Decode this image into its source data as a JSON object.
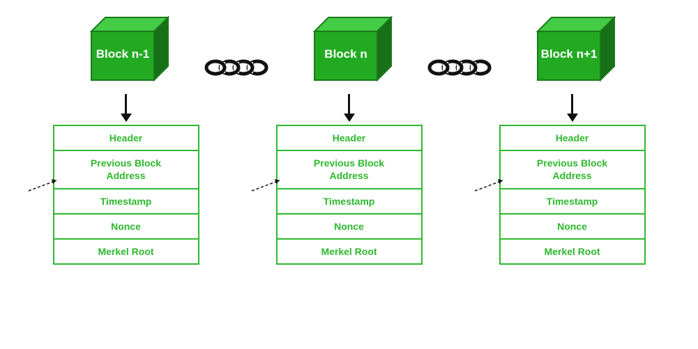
{
  "blocks": [
    {
      "id": "block-n-minus-1",
      "label": "Block n-1",
      "fields": [
        "Header",
        "Previous Block Address",
        "Timestamp",
        "Nonce",
        "Merkel Root"
      ]
    },
    {
      "id": "block-n",
      "label": "Block n",
      "fields": [
        "Header",
        "Previous Block Address",
        "Timestamp",
        "Nonce",
        "Merkel Root"
      ]
    },
    {
      "id": "block-n-plus-1",
      "label": "Block n+1",
      "fields": [
        "Header",
        "Previous Block Address",
        "Timestamp",
        "Nonce",
        "Merkel Root"
      ]
    }
  ],
  "colors": {
    "green": "#22aa22",
    "green_dark": "#1a7a1a",
    "green_mid": "#2eb82e",
    "black": "#111111",
    "white": "#ffffff"
  }
}
